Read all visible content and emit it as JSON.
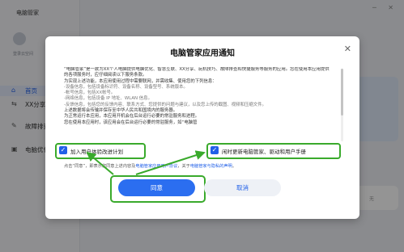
{
  "app": {
    "title": "电脑管家"
  },
  "sidebar": {
    "user_sub": "登录云空间",
    "items": [
      {
        "label": "首页",
        "icon": "home-icon"
      },
      {
        "label": "XX分享",
        "icon": "share-icon"
      },
      {
        "label": "故障排查",
        "icon": "wrench-icon"
      },
      {
        "label": "电脑优化",
        "icon": "optimize-icon"
      }
    ]
  },
  "background": {
    "card_text": "无"
  },
  "dialog": {
    "title": "电脑管家应用通知",
    "paragraphs": [
      "“电脑管家”是一款为XX个人电脑提供电脑优化、智慧互联、XX分享、玩机技巧、故障排查和快捷服务等服务的应用。您在使用本应用提供的各项服务时，应仔细阅读以下服务条款。",
      "为实现上述功能，本应用使用过程中需要联网，并需收集、使用您的下列信息：",
      "-设备信息，包括设备标识符、设备名称、设备型号、系统版本。",
      "-帐号信息，包括XX帐号。",
      "-网络信息，包括设备 IP 地址、WLAN 信息。",
      "-反馈信息，包括您的反馈内容、联系方式、您提供的问题与建议，以及您上传的截图、视频和压缩文件。",
      "上述数据将会传输并保存至中华人民共和国境内的服务器。",
      "为正常运行本应用，本应用开机会在后台运行必要的常驻服务和进程。",
      "您在使用本应用时，该应用会在后台运行必要的常驻服务，如“电脑管"
    ],
    "checks": [
      {
        "label": "加入用户体验改进计划",
        "checked": true
      },
      {
        "label": "闲时更新电脑管家、驱动和用户手册",
        "checked": true
      }
    ],
    "consent_prefix": "点击“同意”，即表示您同意上述内容及",
    "consent_link1": "电脑管家应用用户协议",
    "consent_mid": "，关于",
    "consent_link2": "电脑管家与隐私的声明",
    "consent_suffix": "。",
    "agree_label": "同意",
    "cancel_label": "取消",
    "close_icon": "close-icon"
  },
  "colors": {
    "accent": "#2b6ef0",
    "highlight": "#3aaa2c"
  }
}
